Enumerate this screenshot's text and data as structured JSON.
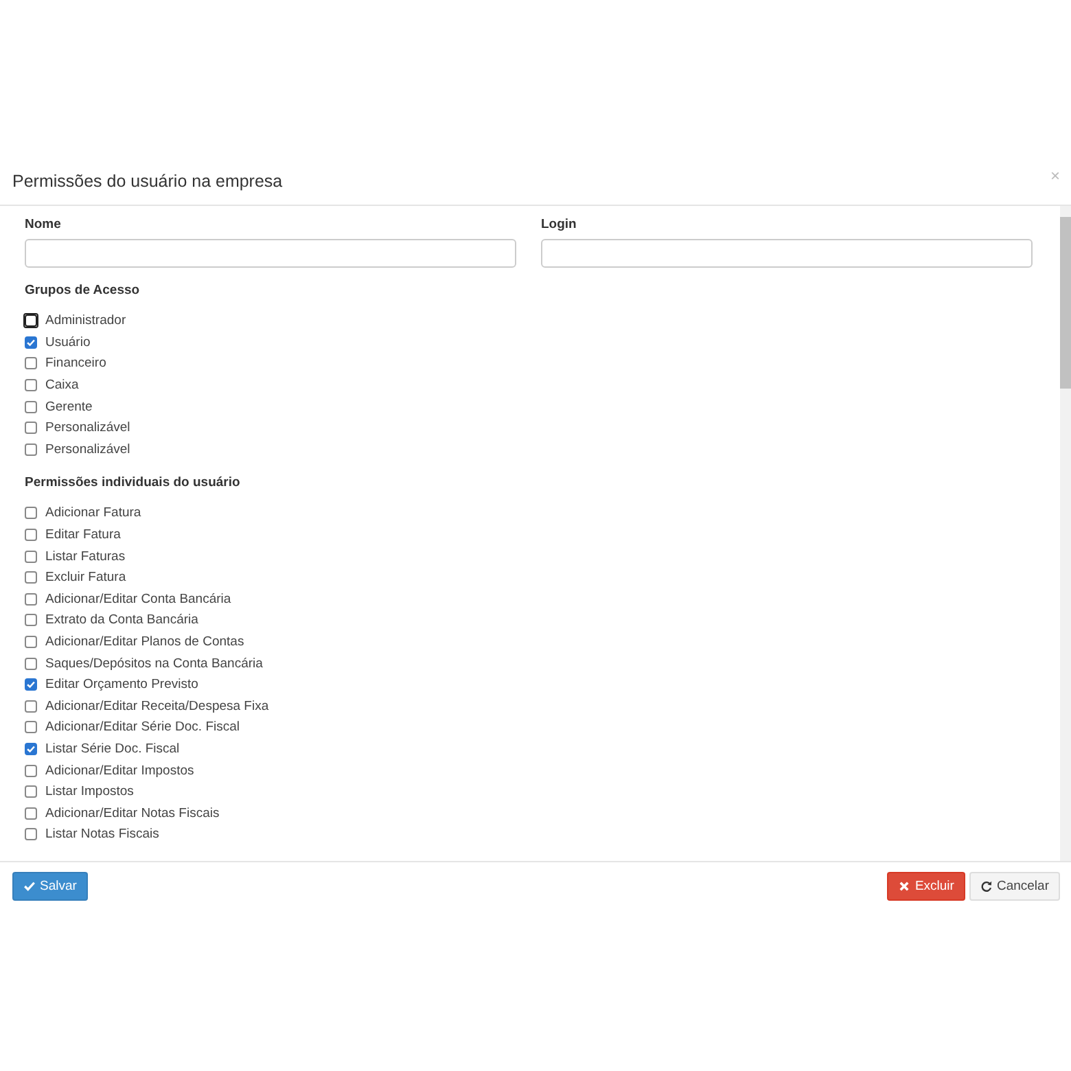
{
  "modal": {
    "title": "Permissões do usuário na empresa",
    "close": "×"
  },
  "fields": [
    {
      "label": "Nome"
    },
    {
      "label": "Login"
    }
  ],
  "groups": {
    "title": "Grupos de Acesso",
    "items": [
      {
        "label": "Administrador",
        "checked": false,
        "focused": true
      },
      {
        "label": "Usuário",
        "checked": true,
        "focused": false
      },
      {
        "label": "Financeiro",
        "checked": false,
        "focused": false
      },
      {
        "label": "Caixa",
        "checked": false,
        "focused": false
      },
      {
        "label": "Gerente",
        "checked": false,
        "focused": false
      },
      {
        "label": "Personalizável",
        "checked": false,
        "focused": false
      },
      {
        "label": "Personalizável",
        "checked": false,
        "focused": false
      }
    ]
  },
  "permissions": {
    "title": "Permissões individuais do usuário",
    "items": [
      {
        "label": "Adicionar Fatura",
        "checked": false
      },
      {
        "label": "Editar Fatura",
        "checked": false
      },
      {
        "label": "Listar Faturas",
        "checked": false
      },
      {
        "label": "Excluir Fatura",
        "checked": false
      },
      {
        "label": "Adicionar/Editar Conta Bancária",
        "checked": false
      },
      {
        "label": "Extrato da Conta Bancária",
        "checked": false
      },
      {
        "label": "Adicionar/Editar Planos de Contas",
        "checked": false
      },
      {
        "label": "Saques/Depósitos na Conta Bancária",
        "checked": false
      },
      {
        "label": "Editar Orçamento Previsto",
        "checked": true
      },
      {
        "label": "Adicionar/Editar Receita/Despesa Fixa",
        "checked": false
      },
      {
        "label": "Adicionar/Editar Série Doc. Fiscal",
        "checked": false
      },
      {
        "label": "Listar Série Doc. Fiscal",
        "checked": true
      },
      {
        "label": "Adicionar/Editar Impostos",
        "checked": false
      },
      {
        "label": "Listar Impostos",
        "checked": false
      },
      {
        "label": "Adicionar/Editar Notas Fiscais",
        "checked": false
      },
      {
        "label": "Listar Notas Fiscais",
        "checked": false
      }
    ]
  },
  "footer": {
    "buttons": [
      {
        "label": "Salvar",
        "kind": "primary"
      },
      {
        "label": "Excluir",
        "kind": "danger"
      },
      {
        "label": "Cancelar",
        "kind": "default"
      }
    ]
  }
}
